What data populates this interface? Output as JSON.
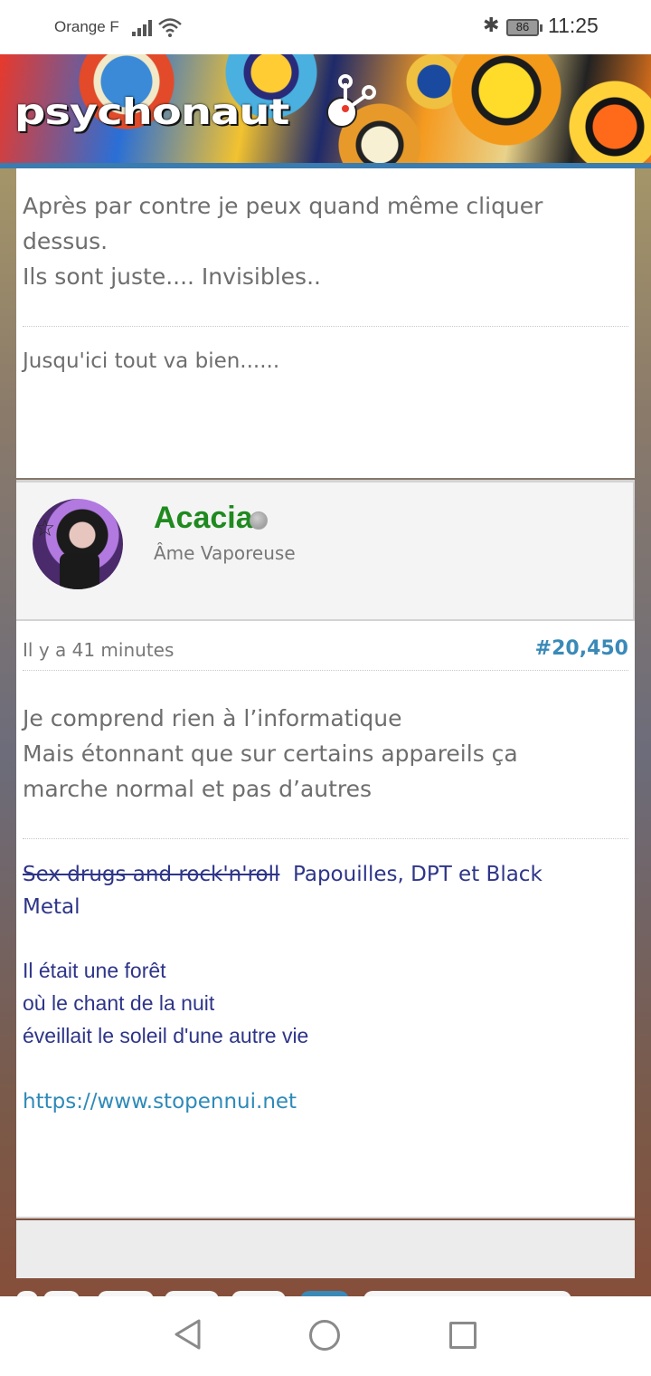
{
  "status_bar": {
    "carrier": "Orange F",
    "battery": "86",
    "time": "11:25",
    "icons": [
      "signal-icon",
      "wifi-icon",
      "bluetooth-icon",
      "battery-icon"
    ]
  },
  "banner": {
    "logo_text": "psychonaut"
  },
  "previous_post": {
    "lines": [
      "Après par contre je peux quand même cliquer",
      "dessus.",
      "Ils sont juste.... Invisibles.."
    ],
    "signature": "Jusqu'ici tout va bien......"
  },
  "author": {
    "name": "Acacia",
    "rank": "Âme Vaporeuse",
    "name_color": "#1f8a1f"
  },
  "post": {
    "time": "Il y a 41 minutes",
    "number": "#20,450",
    "lines": [
      "Je comprend rien à l’informatique",
      "Mais étonnant que sur certains appareils ça",
      "marche normal et pas d’autres"
    ],
    "signature": {
      "struck": "Sex drugs and rock'n'roll",
      "rest_line1": "Papouilles, DPT et Black",
      "rest_line2": "Metal",
      "poem": [
        "Il était une forêt",
        "où le chant de la nuit",
        "éveillait le soleil d'une autre vie"
      ],
      "link": "https://www.stopennui.net"
    }
  },
  "nav_bar": {
    "icons": [
      "back-icon",
      "home-icon",
      "recents-icon"
    ]
  },
  "colors": {
    "accent_blue": "#3a8ab8",
    "signature_blue": "#2e3588",
    "online_status": "#9a9a9a"
  }
}
